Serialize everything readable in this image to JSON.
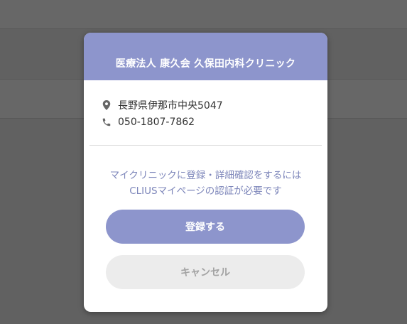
{
  "modal": {
    "title": "医療法人 康久会 久保田内科クリニック",
    "address": "長野県伊那市中央5047",
    "phone": "050-1807-7862",
    "message_line1": "マイクリニックに登録・詳細確認をするには",
    "message_line2": "CLIUSマイページの認証が必要です",
    "register_label": "登録する",
    "cancel_label": "キャンセル"
  },
  "icons": {
    "address": "location-pin-icon",
    "phone": "phone-icon"
  },
  "colors": {
    "accent": "#8d95cc",
    "message_text": "#7d86ba",
    "overlay": "#616161",
    "cancel_bg": "#ececec"
  }
}
